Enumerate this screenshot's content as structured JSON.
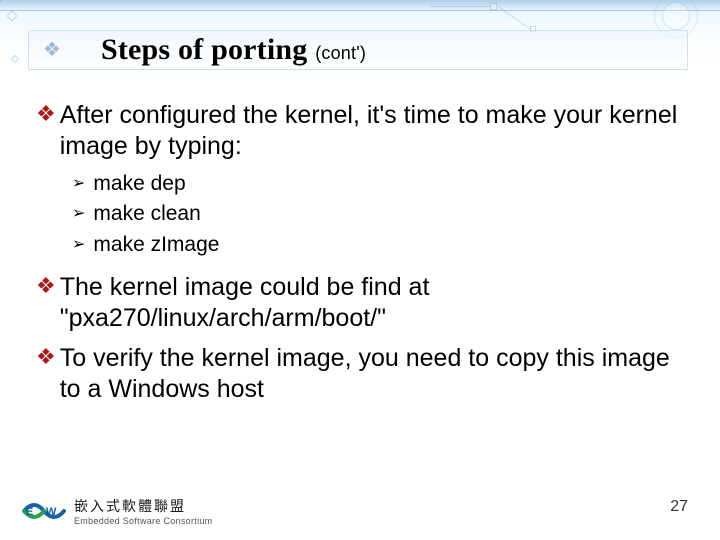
{
  "title": {
    "main": "Steps of porting",
    "suffix": "(cont')"
  },
  "bullets": [
    {
      "text": "After configured the kernel, it's time to make your kernel image by typing:",
      "sub": [
        "make dep",
        "make clean",
        "make zImage"
      ]
    },
    {
      "text": "The kernel image could be find at \"pxa270/linux/arch/arm/boot/\"",
      "sub": []
    },
    {
      "text": "To verify the kernel image, you need to copy this image to a Windows host",
      "sub": []
    }
  ],
  "footer": {
    "logo_line1": "嵌入式軟體聯盟",
    "logo_line2": "Embedded Software Consortium"
  },
  "page_number": "27"
}
